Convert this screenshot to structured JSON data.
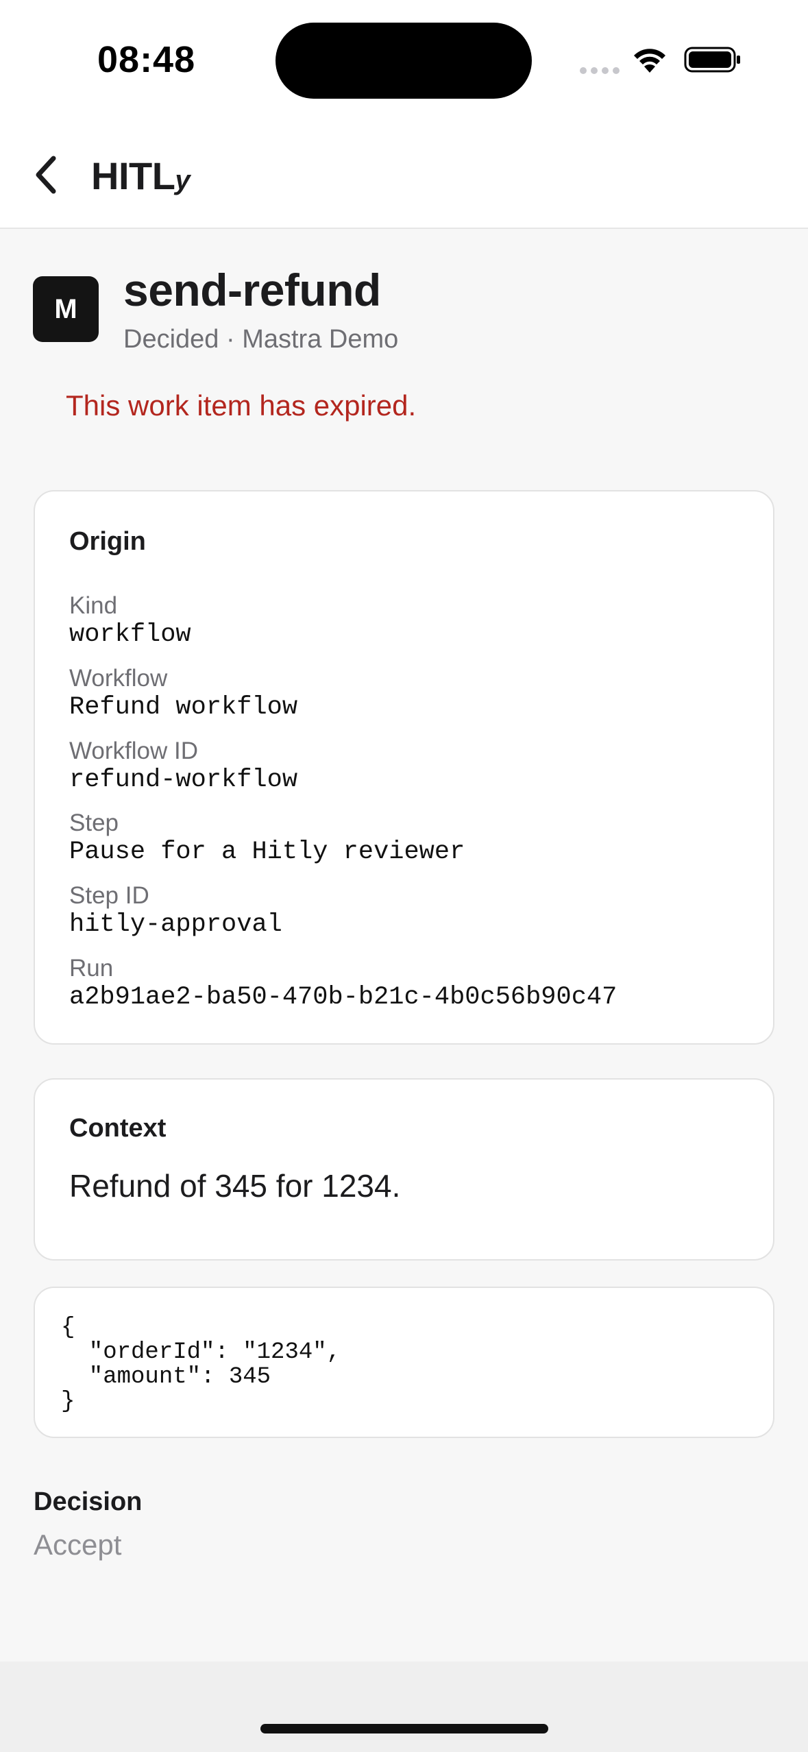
{
  "status_bar": {
    "time": "08:48"
  },
  "header": {
    "back_icon": "chevron-left-icon",
    "brand_main": "HITL",
    "brand_suffix": "y"
  },
  "item": {
    "avatar_letter": "M",
    "title": "send-refund",
    "subtitle": "Decided · Mastra Demo",
    "expired_notice": "This work item has expired.",
    "expired_color": "#b3261e"
  },
  "origin": {
    "heading": "Origin",
    "fields": [
      {
        "label": "Kind",
        "value": "workflow"
      },
      {
        "label": "Workflow",
        "value": "Refund workflow"
      },
      {
        "label": "Workflow ID",
        "value": "refund-workflow"
      },
      {
        "label": "Step",
        "value": "Pause for a Hitly reviewer"
      },
      {
        "label": "Step ID",
        "value": "hitly-approval"
      },
      {
        "label": "Run",
        "value": "a2b91ae2-ba50-470b-b21c-4b0c56b90c47"
      }
    ]
  },
  "context": {
    "heading": "Context",
    "text": "Refund of 345 for 1234."
  },
  "payload": {
    "json": "{\n  \"orderId\": \"1234\",\n  \"amount\": 345\n}"
  },
  "decision": {
    "label": "Decision",
    "value": "Accept"
  }
}
